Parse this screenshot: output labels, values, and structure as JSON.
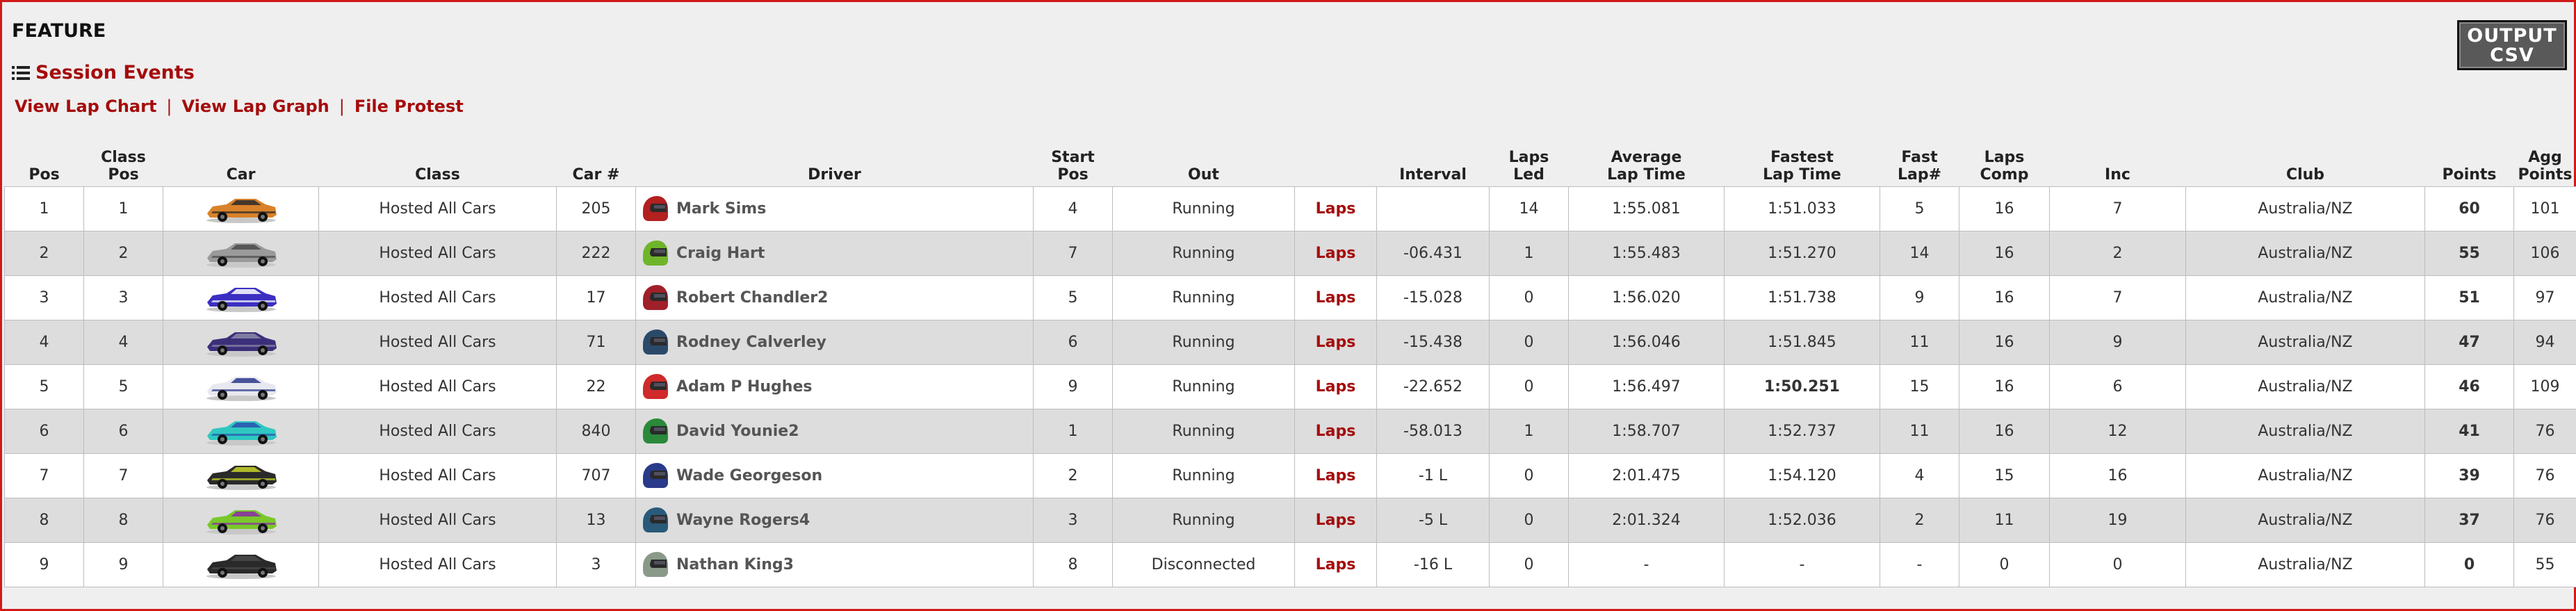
{
  "page": {
    "feature_title": "FEATURE",
    "session_events": "Session Events"
  },
  "links": {
    "lap_chart": "View Lap Chart",
    "lap_graph": "View Lap Graph",
    "protest": "File Protest",
    "separator": "|"
  },
  "csv_button": {
    "line1": "OUTPUT",
    "line2": "CSV"
  },
  "colors": {
    "accent": "#a50c0c",
    "frame": "#d21919",
    "row_alt": "#dddddd",
    "fastest": "#c00000"
  },
  "headers": {
    "pos": "Pos",
    "class_pos": "Class Pos",
    "car": "Car",
    "class": "Class",
    "car_num": "Car #",
    "driver": "Driver",
    "start_pos_1": "Start",
    "start_pos_2": "Pos",
    "out": "Out",
    "laps_link": "",
    "interval": "Interval",
    "laps_led_1": "Laps",
    "laps_led_2": "Led",
    "avg_lap_1": "Average",
    "avg_lap_2": "Lap Time",
    "fastest_lap_1": "Fastest",
    "fastest_lap_2": "Lap Time",
    "fast_lap_num_1": "Fast",
    "fast_lap_num_2": "Lap#",
    "laps_comp_1": "Laps",
    "laps_comp_2": "Comp",
    "inc": "Inc",
    "club": "Club",
    "points": "Points",
    "agg_1": "Agg",
    "agg_2": "Points"
  },
  "rows": [
    {
      "pos": "1",
      "class_pos": "1",
      "car_color": "#d9822b",
      "car_accent": "#2a2a2a",
      "class": "Hosted All Cars",
      "car_num": "205",
      "helmet": "#b32020",
      "driver": "Mark Sims",
      "start": "4",
      "out": "Running",
      "laps": "Laps",
      "interval": "",
      "laps_led": "14",
      "avg": "1:55.081",
      "fastest": "1:51.033",
      "fast_lap": "5",
      "laps_comp": "16",
      "inc": "7",
      "club": "Australia/NZ",
      "points": "60",
      "agg": "101",
      "best": false
    },
    {
      "pos": "2",
      "class_pos": "2",
      "car_color": "#9a9a9a",
      "car_accent": "#4a4a4a",
      "class": "Hosted All Cars",
      "car_num": "222",
      "helmet": "#6fb52a",
      "driver": "Craig Hart",
      "start": "7",
      "out": "Running",
      "laps": "Laps",
      "interval": "-06.431",
      "laps_led": "1",
      "avg": "1:55.483",
      "fastest": "1:51.270",
      "fast_lap": "14",
      "laps_comp": "16",
      "inc": "2",
      "club": "Australia/NZ",
      "points": "55",
      "agg": "106",
      "best": false
    },
    {
      "pos": "3",
      "class_pos": "3",
      "car_color": "#3b2fc2",
      "car_accent": "#ffffff",
      "class": "Hosted All Cars",
      "car_num": "17",
      "helmet": "#a0202a",
      "driver": "Robert Chandler2",
      "start": "5",
      "out": "Running",
      "laps": "Laps",
      "interval": "-15.028",
      "laps_led": "0",
      "avg": "1:56.020",
      "fastest": "1:51.738",
      "fast_lap": "9",
      "laps_comp": "16",
      "inc": "7",
      "club": "Australia/NZ",
      "points": "51",
      "agg": "97",
      "best": false
    },
    {
      "pos": "4",
      "class_pos": "4",
      "car_color": "#3c2f7a",
      "car_accent": "#8a8aa8",
      "class": "Hosted All Cars",
      "car_num": "71",
      "helmet": "#2b4a6a",
      "driver": "Rodney Calverley",
      "start": "6",
      "out": "Running",
      "laps": "Laps",
      "interval": "-15.438",
      "laps_led": "0",
      "avg": "1:56.046",
      "fastest": "1:51.845",
      "fast_lap": "11",
      "laps_comp": "16",
      "inc": "9",
      "club": "Australia/NZ",
      "points": "47",
      "agg": "94",
      "best": false
    },
    {
      "pos": "5",
      "class_pos": "5",
      "car_color": "#e8e8f0",
      "car_accent": "#2a3a8a",
      "class": "Hosted All Cars",
      "car_num": "22",
      "helmet": "#d02a2a",
      "driver": "Adam P Hughes",
      "start": "9",
      "out": "Running",
      "laps": "Laps",
      "interval": "-22.652",
      "laps_led": "0",
      "avg": "1:56.497",
      "fastest": "1:50.251",
      "fast_lap": "15",
      "laps_comp": "16",
      "inc": "6",
      "club": "Australia/NZ",
      "points": "46",
      "agg": "109",
      "best": true
    },
    {
      "pos": "6",
      "class_pos": "6",
      "car_color": "#2fc8c0",
      "car_accent": "#2a50b0",
      "class": "Hosted All Cars",
      "car_num": "840",
      "helmet": "#2a8a3a",
      "driver": "David Younie2",
      "start": "1",
      "out": "Running",
      "laps": "Laps",
      "interval": "-58.013",
      "laps_led": "1",
      "avg": "1:58.707",
      "fastest": "1:52.737",
      "fast_lap": "11",
      "laps_comp": "16",
      "inc": "12",
      "club": "Australia/NZ",
      "points": "41",
      "agg": "76",
      "best": false
    },
    {
      "pos": "7",
      "class_pos": "7",
      "car_color": "#2a2a2a",
      "car_accent": "#c8d42a",
      "class": "Hosted All Cars",
      "car_num": "707",
      "helmet": "#2a3a8a",
      "driver": "Wade Georgeson",
      "start": "2",
      "out": "Running",
      "laps": "Laps",
      "interval": "-1 L",
      "laps_led": "0",
      "avg": "2:01.475",
      "fastest": "1:54.120",
      "fast_lap": "4",
      "laps_comp": "15",
      "inc": "16",
      "club": "Australia/NZ",
      "points": "39",
      "agg": "76",
      "best": false
    },
    {
      "pos": "8",
      "class_pos": "8",
      "car_color": "#7ac82a",
      "car_accent": "#8a2aa8",
      "class": "Hosted All Cars",
      "car_num": "13",
      "helmet": "#2a5a7a",
      "driver": "Wayne Rogers4",
      "start": "3",
      "out": "Running",
      "laps": "Laps",
      "interval": "-5 L",
      "laps_led": "0",
      "avg": "2:01.324",
      "fastest": "1:52.036",
      "fast_lap": "2",
      "laps_comp": "11",
      "inc": "19",
      "club": "Australia/NZ",
      "points": "37",
      "agg": "76",
      "best": false
    },
    {
      "pos": "9",
      "class_pos": "9",
      "car_color": "#2a2a2a",
      "car_accent": "#4a4a4a",
      "class": "Hosted All Cars",
      "car_num": "3",
      "helmet": "#8a9a8a",
      "driver": "Nathan King3",
      "start": "8",
      "out": "Disconnected",
      "laps": "Laps",
      "interval": "-16 L",
      "laps_led": "0",
      "avg": "-",
      "fastest": "-",
      "fast_lap": "-",
      "laps_comp": "0",
      "inc": "0",
      "club": "Australia/NZ",
      "points": "0",
      "agg": "55",
      "best": false
    }
  ]
}
